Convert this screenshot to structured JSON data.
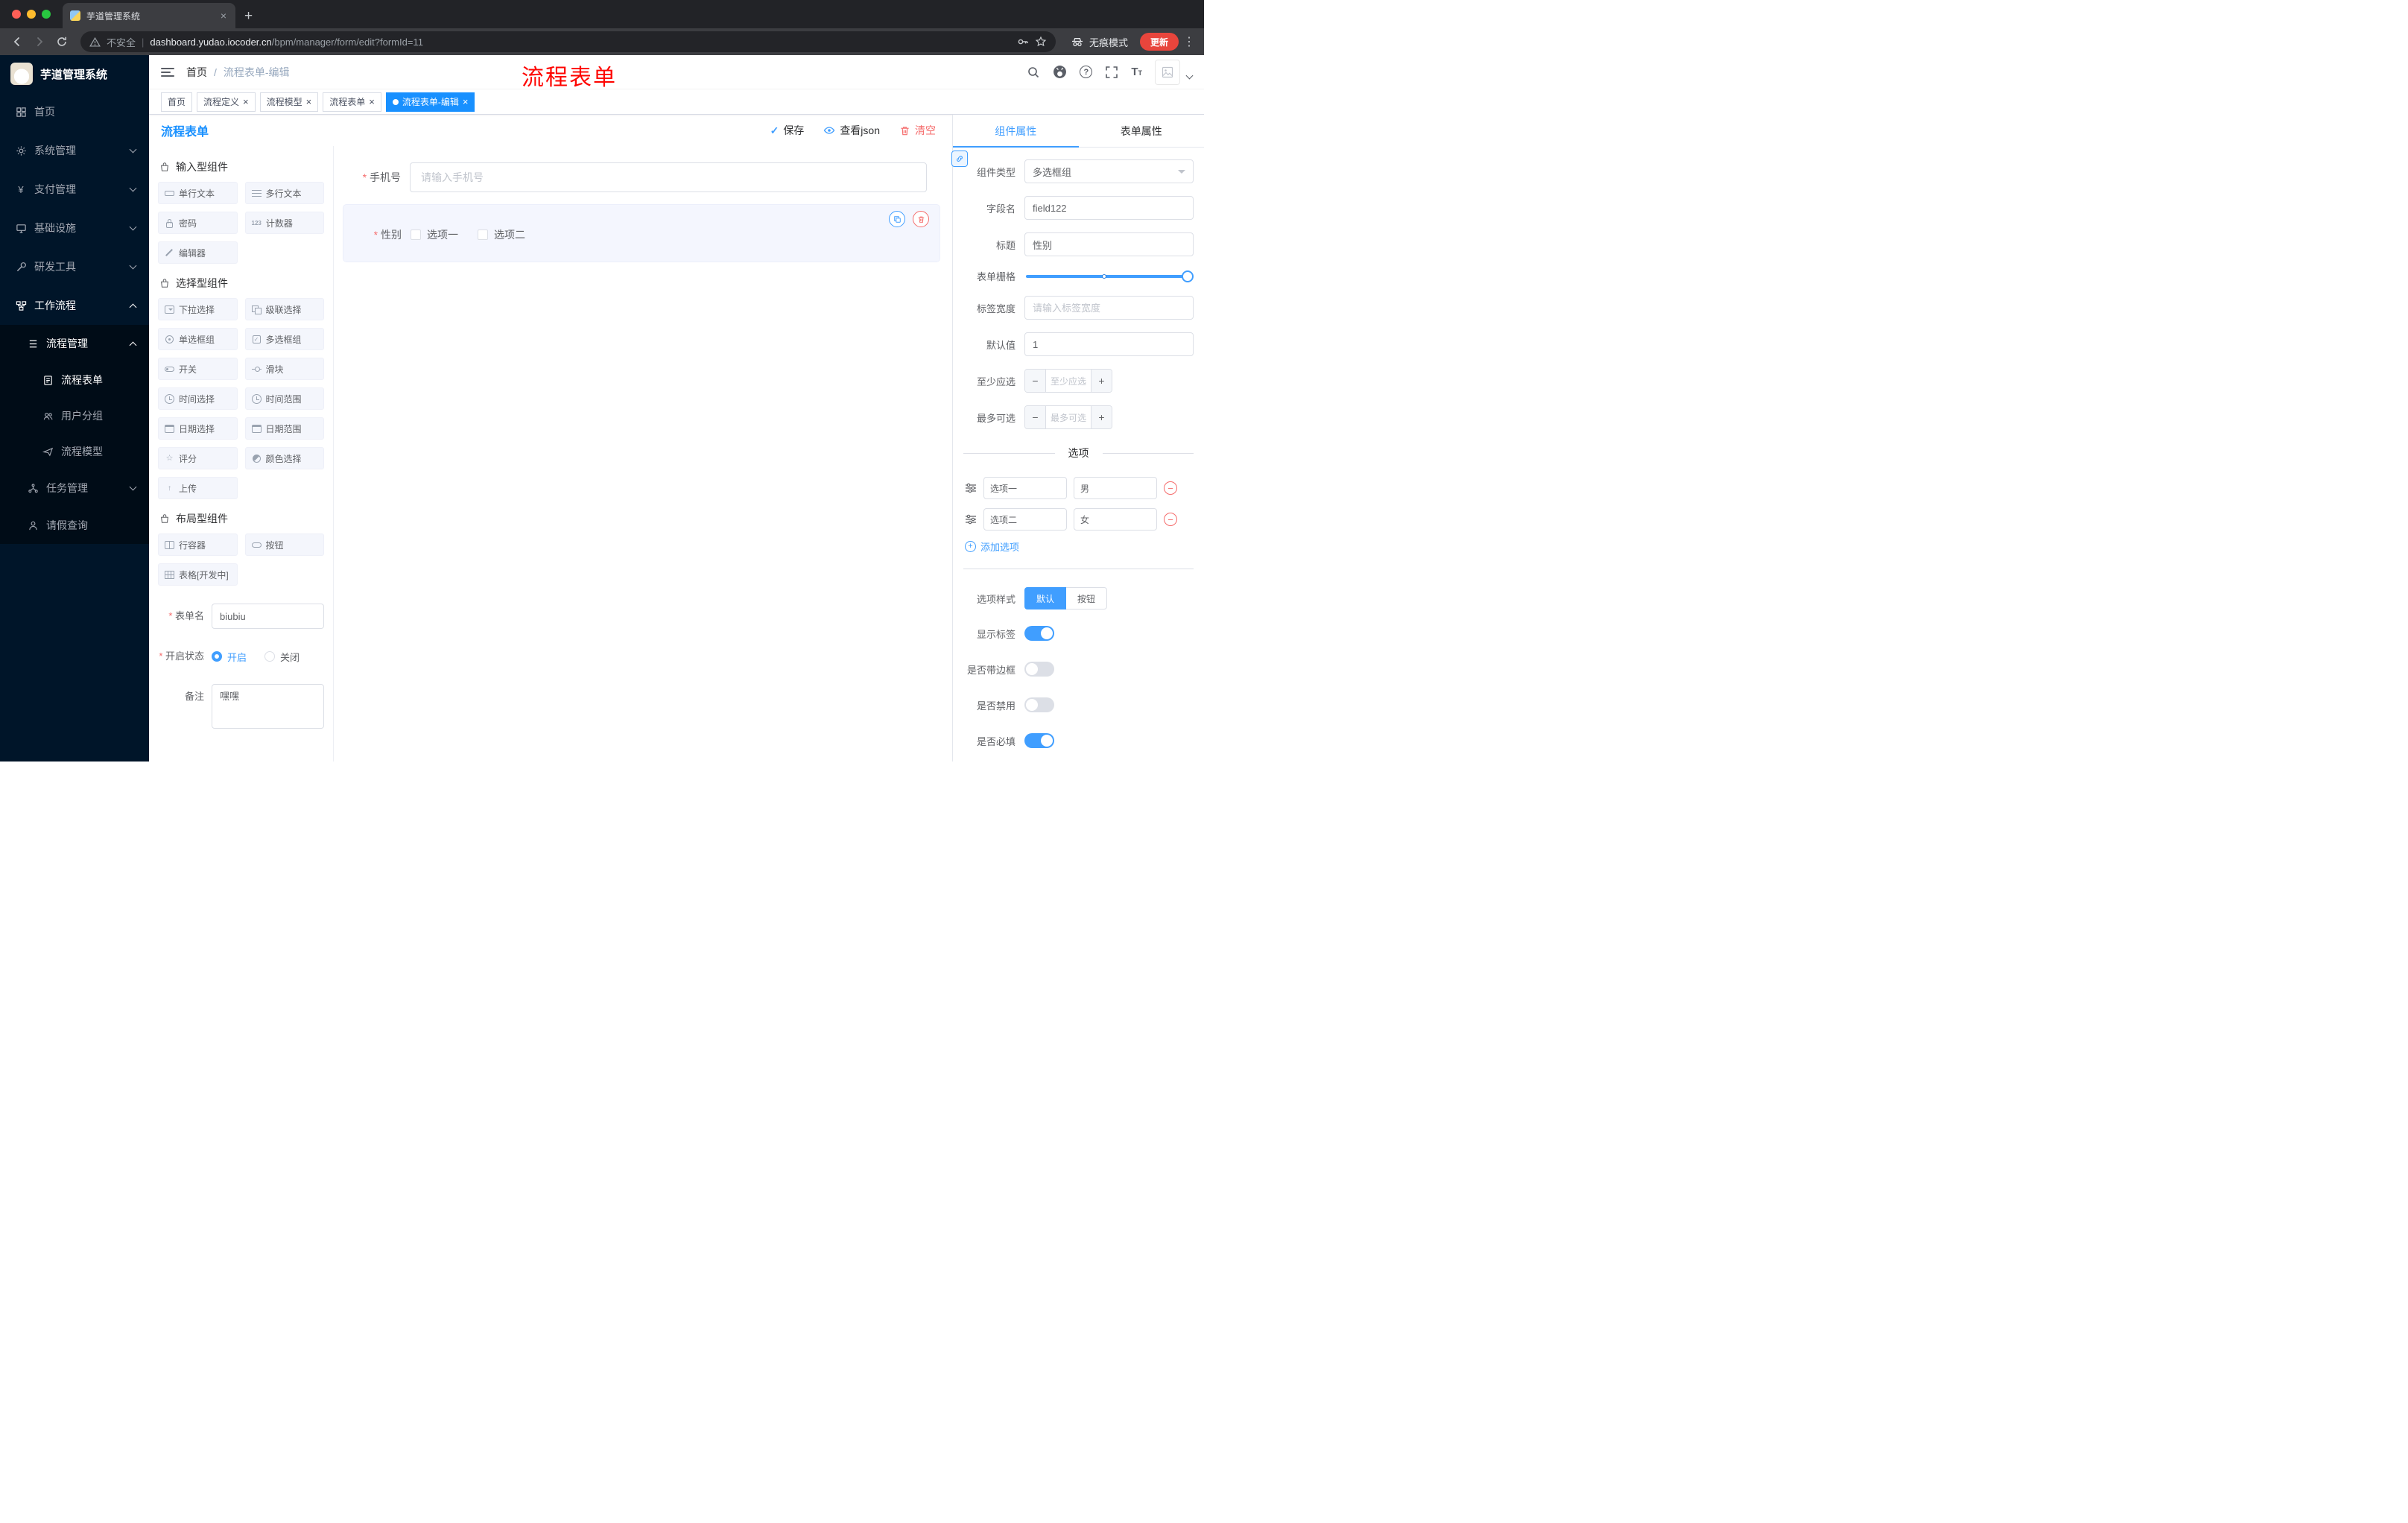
{
  "window": {
    "tab_title": "芋道管理系统",
    "security_label": "不安全",
    "url_domain": "dashboard.yudao.iocoder.cn",
    "url_path": "/bpm/manager/form/edit?formId=11",
    "incognito_label": "无痕模式",
    "update_label": "更新"
  },
  "sidebar": {
    "title": "芋道管理系统",
    "items": [
      {
        "label": "首页"
      },
      {
        "label": "系统管理"
      },
      {
        "label": "支付管理"
      },
      {
        "label": "基础设施"
      },
      {
        "label": "研发工具"
      },
      {
        "label": "工作流程"
      },
      {
        "label": "流程管理"
      },
      {
        "label": "流程表单"
      },
      {
        "label": "用户分组"
      },
      {
        "label": "流程模型"
      },
      {
        "label": "任务管理"
      },
      {
        "label": "请假查询"
      }
    ]
  },
  "header": {
    "crumb_home": "首页",
    "crumb_sep": "/",
    "crumb_current": "流程表单-编辑",
    "annotation": "流程表单"
  },
  "tags": [
    {
      "label": "首页",
      "closable": false,
      "active": false
    },
    {
      "label": "流程定义",
      "closable": true,
      "active": false
    },
    {
      "label": "流程模型",
      "closable": true,
      "active": false
    },
    {
      "label": "流程表单",
      "closable": true,
      "active": false
    },
    {
      "label": "流程表单-编辑",
      "closable": true,
      "active": true
    }
  ],
  "designer": {
    "title": "流程表单",
    "actions": {
      "save": "保存",
      "view_json": "查看json",
      "clear": "清空"
    },
    "groups": [
      {
        "title": "输入型组件",
        "items": [
          "单行文本",
          "多行文本",
          "密码",
          "计数器",
          "编辑器"
        ]
      },
      {
        "title": "选择型组件",
        "items": [
          "下拉选择",
          "级联选择",
          "单选框组",
          "多选框组",
          "开关",
          "滑块",
          "时间选择",
          "时间范围",
          "日期选择",
          "日期范围",
          "评分",
          "颜色选择",
          "上传"
        ]
      },
      {
        "title": "布局型组件",
        "items": [
          "行容器",
          "按钮",
          "表格[开发中]"
        ]
      }
    ],
    "meta": {
      "name_label": "表单名",
      "name_value": "biubiu",
      "status_label": "开启状态",
      "status_on": "开启",
      "status_off": "关闭",
      "status_selected": "开启",
      "remark_label": "备注",
      "remark_value": "嘿嘿"
    },
    "canvas": {
      "phone_label": "手机号",
      "phone_placeholder": "请输入手机号",
      "gender_label": "性别",
      "gender_options": [
        "选项一",
        "选项二"
      ]
    }
  },
  "props": {
    "tabs": [
      "组件属性",
      "表单属性"
    ],
    "active_tab": "组件属性",
    "component_type_label": "组件类型",
    "component_type_value": "多选框组",
    "field_name_label": "字段名",
    "field_name_value": "field122",
    "title_label": "标题",
    "title_value": "性别",
    "grid_label": "表单栅格",
    "label_width_label": "标签宽度",
    "label_width_placeholder": "请输入标签宽度",
    "default_label": "默认值",
    "default_value": "1",
    "min_label": "至少应选",
    "min_placeholder": "至少应选",
    "max_label": "最多可选",
    "max_placeholder": "最多可选",
    "options_title": "选项",
    "options": [
      {
        "label": "选项一",
        "value": "男"
      },
      {
        "label": "选项二",
        "value": "女"
      }
    ],
    "add_option_label": "添加选项",
    "option_style_label": "选项样式",
    "option_style_default": "默认",
    "option_style_button": "按钮",
    "option_style_selected": "默认",
    "show_label_label": "显示标签",
    "show_label_on": true,
    "border_label": "是否带边框",
    "border_on": false,
    "disabled_label": "是否禁用",
    "disabled_on": false,
    "required_label": "是否必填",
    "required_on": true
  },
  "icons": {
    "check": "✓",
    "close": "×",
    "plus": "+",
    "minus": "−",
    "more": "⋮",
    "question": "?",
    "yen": "¥",
    "star": "☆",
    "upload": "↑",
    "counter": "123",
    "font_size": "T"
  },
  "colors": {
    "primary": "#1890ff",
    "accent": "#409eff",
    "danger": "#f56c6c",
    "sidebar_bg": "#001529",
    "submenu_bg": "#000c17",
    "annotation_red": "#fe0400",
    "update_chip": "#e8453c"
  }
}
